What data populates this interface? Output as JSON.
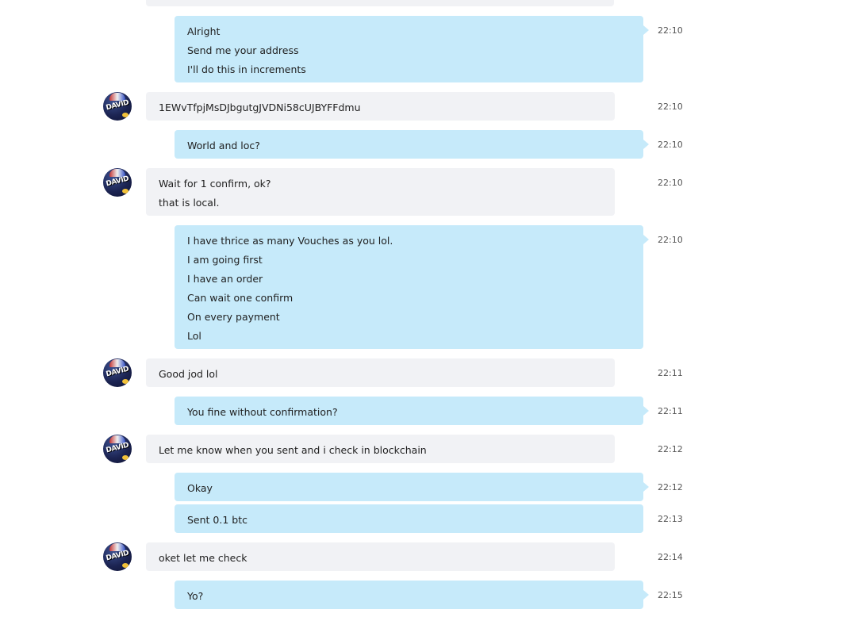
{
  "chat": {
    "avatar_text": "DAVID",
    "messages": [
      {
        "dir": "out",
        "time": "22:10",
        "lines": [
          "Alright",
          "Send me your address",
          "I'll do this in increments"
        ]
      },
      {
        "dir": "in",
        "time": "22:10",
        "lines": [
          "1EWvTfpjMsDJbgutgJVDNi58cUJBYFFdmu"
        ]
      },
      {
        "dir": "out",
        "time": "22:10",
        "lines": [
          "World and loc?"
        ]
      },
      {
        "dir": "in",
        "time": "22:10",
        "lines": [
          "Wait for 1 confirm, ok?",
          "that is local."
        ]
      },
      {
        "dir": "out",
        "time": "22:10",
        "lines": [
          "I have thrice as many Vouches as you lol.",
          "I am going first",
          "I have an order",
          "Can wait one confirm",
          "On every payment",
          "Lol"
        ]
      },
      {
        "dir": "in",
        "time": "22:11",
        "lines": [
          "Good jod lol"
        ]
      },
      {
        "dir": "out",
        "time": "22:11",
        "lines": [
          "You fine without confirmation?"
        ]
      },
      {
        "dir": "in",
        "time": "22:12",
        "lines": [
          "Let me know when you sent and i check in blockchain"
        ]
      },
      {
        "dir": "out",
        "time": "22:12",
        "lines": [
          "Okay"
        ]
      },
      {
        "dir": "out",
        "time": "22:13",
        "lines": [
          "Sent 0.1 btc"
        ]
      },
      {
        "dir": "in",
        "time": "22:14",
        "lines": [
          "oket let me check"
        ]
      },
      {
        "dir": "out",
        "time": "22:15",
        "lines": [
          "Yo?"
        ]
      }
    ]
  }
}
